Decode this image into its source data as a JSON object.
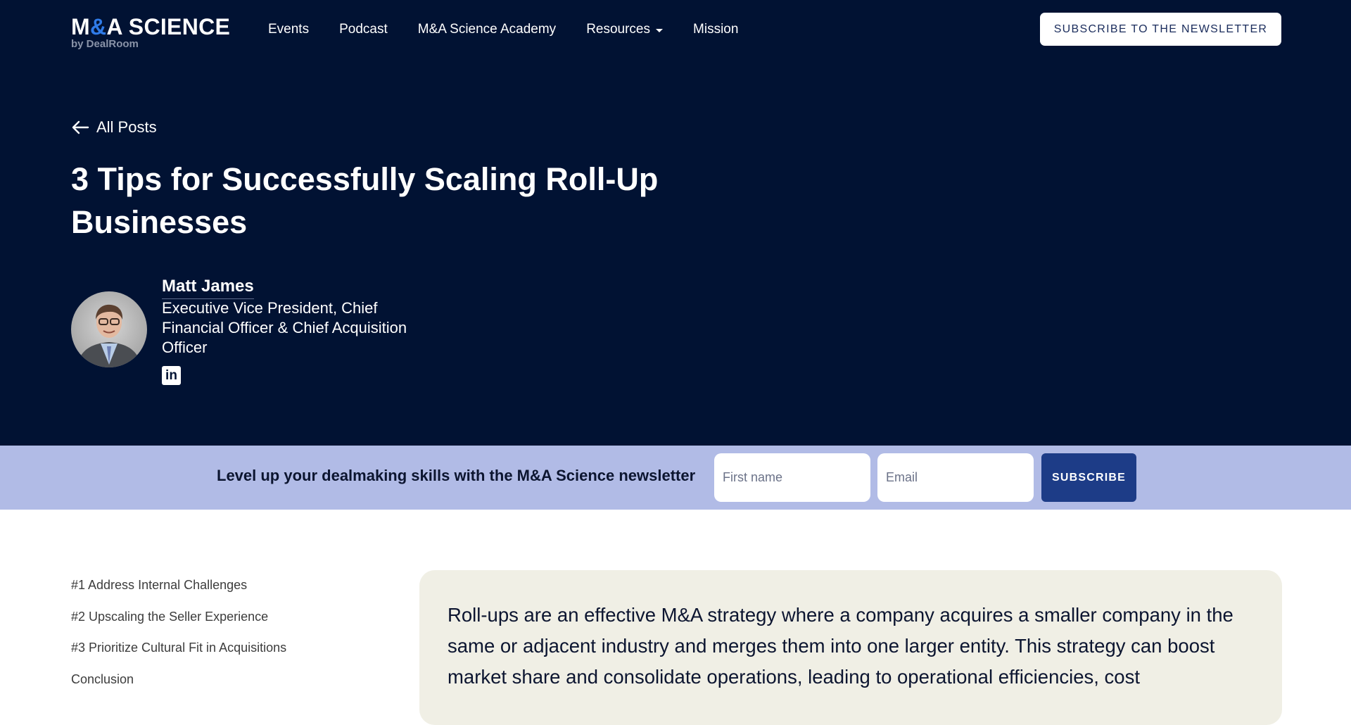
{
  "header": {
    "logo": {
      "main_prefix": "M",
      "main_amp": "&",
      "main_suffix": "A SCIENCE",
      "sub": "by DealRoom",
      "accent_color": "#2f7be8"
    },
    "nav": [
      {
        "label": "Events",
        "has_dropdown": false
      },
      {
        "label": "Podcast",
        "has_dropdown": false
      },
      {
        "label": "M&A Science Academy",
        "has_dropdown": false
      },
      {
        "label": "Resources",
        "has_dropdown": true
      },
      {
        "label": "Mission",
        "has_dropdown": false
      }
    ],
    "cta_label": "SUBSCRIBE TO THE NEWSLETTER"
  },
  "article": {
    "back_label": "All Posts",
    "title": "3 Tips for Successfully Scaling Roll-Up Businesses",
    "author": {
      "name": "Matt James",
      "title": "Executive Vice President, Chief Financial Officer & Chief Acquisition Officer",
      "social": "linkedin-icon"
    }
  },
  "newsletter": {
    "text": "Level up your dealmaking skills with the M&A Science newsletter",
    "first_name_placeholder": "First name",
    "first_name_value": "",
    "email_placeholder": "Email",
    "email_value": "",
    "button_label": "SUBSCRIBE"
  },
  "toc": [
    {
      "label": "#1 Address Internal Challenges"
    },
    {
      "label": "#2 Upscaling the Seller Experience"
    },
    {
      "label": "#3 Prioritize Cultural Fit in Acquisitions"
    },
    {
      "label": "Conclusion"
    }
  ],
  "intro": {
    "text": "Roll-ups are an effective M&A strategy where a company acquires a smaller company in the same or adjacent industry and merges them into one larger entity. This strategy can boost market share and consolidate operations, leading to operational efficiencies, cost"
  },
  "colors": {
    "hero_bg": "#011233",
    "band_bg": "#b1bbe6",
    "button_blue": "#1d3c87",
    "card_bg": "#f0efe5"
  }
}
